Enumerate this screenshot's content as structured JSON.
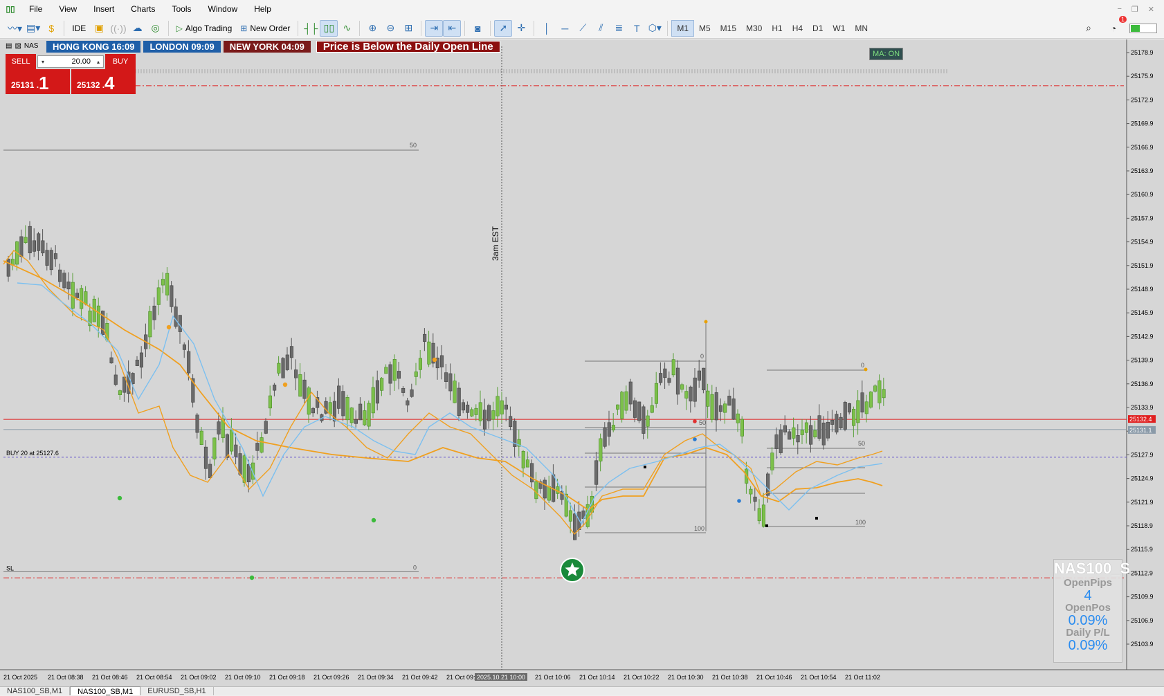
{
  "menu": {
    "app_logo": "▯▯",
    "items": [
      "File",
      "View",
      "Insert",
      "Charts",
      "Tools",
      "Window",
      "Help"
    ],
    "window_controls": [
      "−",
      "❐",
      "✕"
    ]
  },
  "toolbar": {
    "ide_label": "IDE",
    "algo_trading_label": "Algo Trading",
    "new_order_label": "New Order",
    "timeframes": [
      "M1",
      "M5",
      "M15",
      "M30",
      "H1",
      "H4",
      "D1",
      "W1",
      "MN"
    ],
    "active_timeframe": "M1",
    "notification_count": "1"
  },
  "trade_panel": {
    "sell_label": "SELL",
    "buy_label": "BUY",
    "lot_value": "20.00",
    "bid_small": "25131 .",
    "bid_big": "1",
    "ask_small": "25132 .",
    "ask_big": "4"
  },
  "symbol_short": "NAS",
  "sessions": {
    "hong_kong": "HONG KONG 16:09",
    "london": "LONDON  09:09",
    "new_york": "NEW YORK  04:09",
    "message": "Price is Below the Daily Open Line"
  },
  "ma_badge": "MA: ON",
  "chart": {
    "vertical_line_label": "3am EST",
    "buy_line_label": "BUY 20 at 25127.6",
    "sl_label": "SL",
    "current_ask": "25132.4",
    "current_bid": "25131.1",
    "time_highlight": "2025.10.21 10:00",
    "fib_labels": {
      "f50_top": "50",
      "f0_left": "0",
      "f0_mid": "0",
      "f50_mid": "50",
      "f100_mid": "100",
      "f0_right": "0",
      "f50_right": "50",
      "f100_right": "100"
    }
  },
  "chart_data": {
    "type": "candlestick",
    "price_axis": [
      "25178.9",
      "25175.9",
      "25172.9",
      "25169.9",
      "25166.9",
      "25163.9",
      "25160.9",
      "25157.9",
      "25154.9",
      "25151.9",
      "25148.9",
      "25145.9",
      "25142.9",
      "25139.9",
      "25136.9",
      "25133.9",
      "25130.9",
      "25127.9",
      "25124.9",
      "25121.9",
      "25118.9",
      "25115.9",
      "25112.9",
      "25109.9",
      "25106.9",
      "25103.9"
    ],
    "ylim": [
      25101.7,
      25180.1
    ],
    "time_axis": [
      "21 Oct 2025",
      "21 Oct 08:38",
      "21 Oct 08:46",
      "21 Oct 08:54",
      "21 Oct 09:02",
      "21 Oct 09:10",
      "21 Oct 09:18",
      "21 Oct 09:26",
      "21 Oct 09:34",
      "21 Oct 09:42",
      "21 Oct 09:5",
      "",
      "21 Oct 10:06",
      "21 Oct 10:14",
      "21 Oct 10:22",
      "21 Oct 10:30",
      "21 Oct 10:38",
      "21 Oct 10:46",
      "21 Oct 10:54",
      "21 Oct 11:02"
    ],
    "horizontal_lines": {
      "daily_open": 25132.4,
      "bid": 25131.1,
      "buy_entry": 25127.6,
      "stop_loss": 25112.9,
      "upper_dashdot": 25174.7,
      "lower_dashdot": 25112.3,
      "top_ref": 25163.6
    }
  },
  "info_panel": {
    "symbol": "NAS100_S",
    "open_pips_label": "OpenPips",
    "open_pips_value": "4",
    "open_pos_label": "OpenPos",
    "open_pos_value": "0.09%",
    "daily_pl_label": "Daily P/L",
    "daily_pl_value": "0.09%"
  },
  "bottom_tabs": [
    "NAS100_SB,M1",
    "NAS100_SB,M1",
    "EURUSD_SB,H1"
  ],
  "active_tab_index": 1
}
